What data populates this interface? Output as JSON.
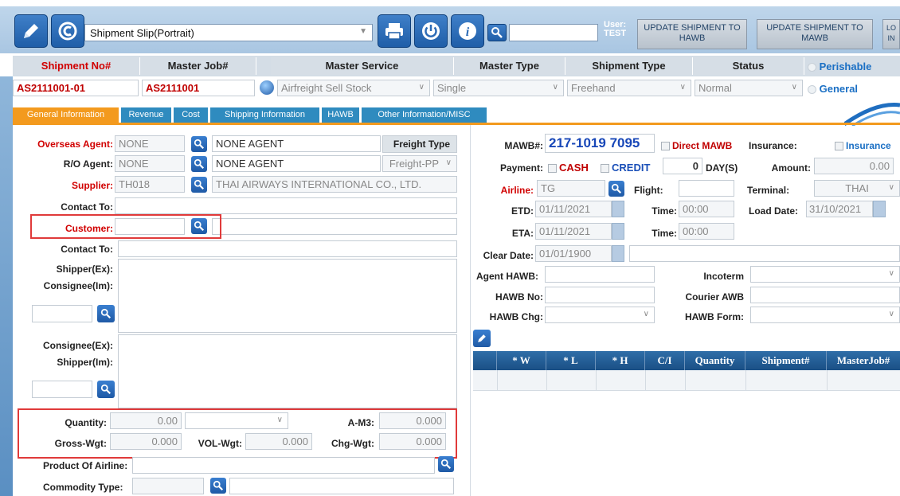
{
  "toolbar": {
    "slip_select": "Shipment Slip(Portrait)",
    "search_value": "",
    "user_label": "User:",
    "user_name": "TEST",
    "update_hawb": "UPDATE SHIPMENT TO HAWB",
    "update_mawb": "UPDATE SHIPMENT TO MAWB",
    "cut_btn": "LO IN"
  },
  "header": {
    "shipment_no": "Shipment No#",
    "master_job": "Master Job#",
    "master_service": "Master Service",
    "master_type": "Master Type",
    "shipment_type": "Shipment Type",
    "status": "Status",
    "perishable": "Perishable",
    "general": "General"
  },
  "values": {
    "shipment_no": "AS2111001-01",
    "master_job": "AS2111001",
    "master_service": "Airfreight Sell Stock",
    "master_type": "Single",
    "shipment_type": "Freehand",
    "status": "Normal"
  },
  "tabs": [
    "General Information",
    "Revenue",
    "Cost",
    "Shipping Information",
    "HAWB",
    "Other Information/MISC"
  ],
  "left": {
    "overseas_agent_label": "Overseas Agent:",
    "overseas_agent_code": "NONE",
    "overseas_agent_name": "NONE AGENT",
    "freight_type_label": "Freight Type",
    "ro_agent_label": "R/O Agent:",
    "ro_agent_code": "NONE",
    "ro_agent_name": "NONE AGENT",
    "freight_type_value": "Freight-PP",
    "supplier_label": "Supplier:",
    "supplier_code": "TH018",
    "supplier_name": "THAI AIRWAYS INTERNATIONAL CO., LTD.",
    "contact_to_label": "Contact To:",
    "customer_label": "Customer:",
    "contact_to2_label": "Contact To:",
    "shipper_ex_label": "Shipper(Ex):",
    "consignee_im_label": "Consignee(Im):",
    "consignee_ex_label": "Consignee(Ex):",
    "shipper_im_label": "Shipper(Im):",
    "quantity_label": "Quantity:",
    "quantity_value": "0.00",
    "am3_label": "A-M3:",
    "am3_value": "0.000",
    "gross_label": "Gross-Wgt:",
    "gross_value": "0.000",
    "vol_label": "VOL-Wgt:",
    "vol_value": "0.000",
    "chg_label": "Chg-Wgt:",
    "chg_value": "0.000",
    "product_airline_label": "Product Of Airline:",
    "commodity_label": "Commodity Type:"
  },
  "right": {
    "mawb_label": "MAWB#:",
    "mawb_value": "217-1019 7095",
    "direct_mawb": "Direct MAWB",
    "insurance_label": "Insurance:",
    "insurance_chk": "Insurance",
    "payment_label": "Payment:",
    "cash": "CASH",
    "credit": "CREDIT",
    "days_value": "0",
    "days_label": "DAY(S)",
    "amount_label": "Amount:",
    "amount_value": "0.00",
    "airline_label": "Airline:",
    "airline_value": "TG",
    "flight_label": "Flight:",
    "terminal_label": "Terminal:",
    "terminal_value": "THAI",
    "etd_label": "ETD:",
    "etd_value": "01/11/2021",
    "time_label": "Time:",
    "etd_time": "00:00",
    "load_date_label": "Load Date:",
    "load_date_value": "31/10/2021",
    "eta_label": "ETA:",
    "eta_value": "01/11/2021",
    "eta_time": "00:00",
    "clear_date_label": "Clear Date:",
    "clear_date_value": "01/01/1900",
    "agent_hawb_label": "Agent HAWB:",
    "incoterm_label": "Incoterm",
    "hawb_no_label": "HAWB No:",
    "courier_awb_label": "Courier AWB",
    "hawb_chg_label": "HAWB Chg:",
    "hawb_form_label": "HAWB Form:"
  },
  "grid": {
    "columns": [
      "* W",
      "* L",
      "* H",
      "C/I",
      "Quantity",
      "Shipment#",
      "MasterJob#"
    ]
  }
}
